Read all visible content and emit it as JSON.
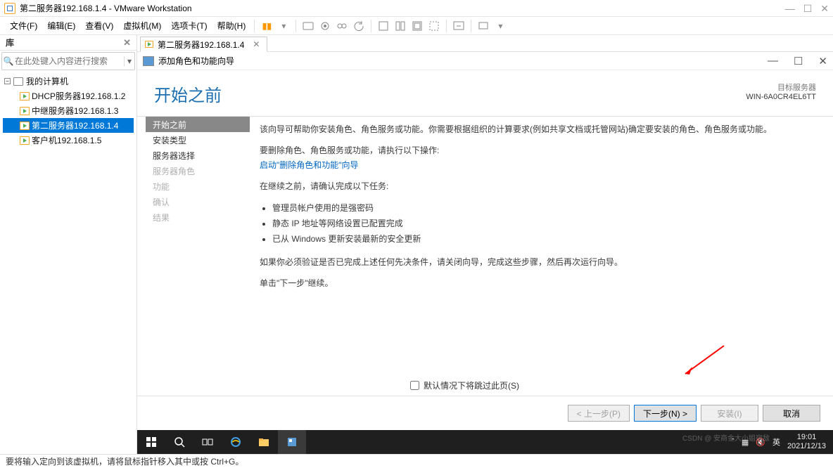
{
  "titlebar": {
    "title": "第二服务器192.168.1.4 - VMware Workstation"
  },
  "menus": [
    "文件(F)",
    "编辑(E)",
    "查看(V)",
    "虚拟机(M)",
    "选项卡(T)",
    "帮助(H)"
  ],
  "sidebar": {
    "title": "库",
    "search_placeholder": "在此处键入内容进行搜索",
    "root": "我的计算机",
    "vms": [
      {
        "label": "DHCP服务器192.168.1.2",
        "selected": false
      },
      {
        "label": "中继服务器192.168.1.3",
        "selected": false
      },
      {
        "label": "第二服务器192.168.1.4",
        "selected": true
      },
      {
        "label": "客户机192.168.1.5",
        "selected": false
      }
    ]
  },
  "tab": {
    "label": "第二服务器192.168.1.4"
  },
  "wizard": {
    "title": "添加角色和功能向导",
    "heading": "开始之前",
    "target_label": "目标服务器",
    "target_server": "WIN-6A0CR4EL6TT",
    "nav": [
      {
        "label": "开始之前",
        "state": "selected"
      },
      {
        "label": "安装类型",
        "state": ""
      },
      {
        "label": "服务器选择",
        "state": ""
      },
      {
        "label": "服务器角色",
        "state": "dis"
      },
      {
        "label": "功能",
        "state": "dis"
      },
      {
        "label": "确认",
        "state": "dis"
      },
      {
        "label": "结果",
        "state": "dis"
      }
    ],
    "intro": "该向导可帮助你安装角色、角色服务或功能。你需要根据组织的计算要求(例如共享文档或托管网站)确定要安装的角色、角色服务或功能。",
    "remove_prefix": "要删除角色、角色服务或功能，请执行以下操作:",
    "remove_link": "启动\"删除角色和功能\"向导",
    "verify_prefix": "在继续之前，请确认完成以下任务:",
    "bullets": [
      "管理员帐户使用的是强密码",
      "静态 IP 地址等网络设置已配置完成",
      "已从 Windows 更新安装最新的安全更新"
    ],
    "verify_note": "如果你必须验证是否已完成上述任何先决条件，请关闭向导，完成这些步骤，然后再次运行向导。",
    "click_next": "单击\"下一步\"继续。",
    "skip_label": "默认情况下将跳过此页(S)",
    "buttons": {
      "prev": "< 上一步(P)",
      "next": "下一步(N) >",
      "install": "安装(I)",
      "cancel": "取消"
    }
  },
  "taskbar": {
    "ime": "英",
    "time": "19:01",
    "date": "2021/12/13",
    "watermark": "CSDN @ 安商金大小姐宿敌"
  },
  "statusbar": {
    "text": "要将输入定向到该虚拟机，请将鼠标指针移入其中或按 Ctrl+G。"
  }
}
